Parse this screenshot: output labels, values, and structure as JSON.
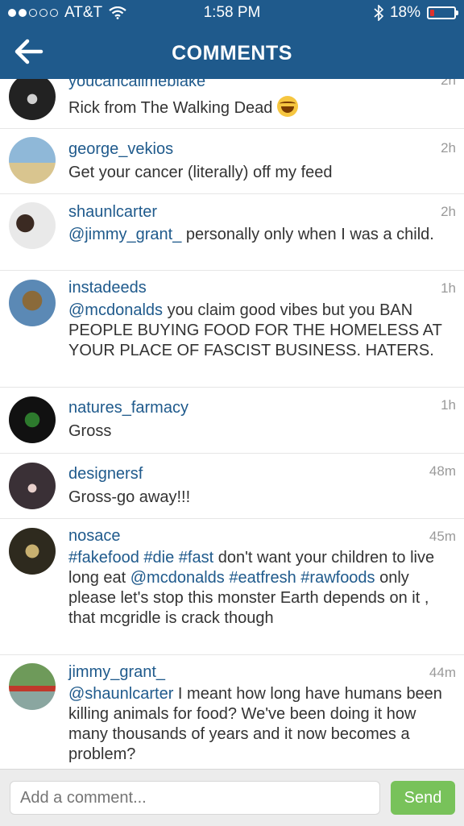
{
  "status": {
    "carrier": "AT&T",
    "time": "1:58 PM",
    "battery": "18%",
    "battery_level": 0.18
  },
  "nav": {
    "title": "COMMENTS"
  },
  "comments": [
    {
      "username": "youcancallmeblake",
      "time": "2h",
      "parts": [
        {
          "t": "text",
          "v": "Rick from The Walking Dead "
        }
      ],
      "emoji": "joy"
    },
    {
      "username": "george_vekios",
      "time": "2h",
      "parts": [
        {
          "t": "text",
          "v": "Get your cancer (literally) off my feed"
        }
      ]
    },
    {
      "username": "shaunlcarter",
      "time": "2h",
      "parts": [
        {
          "t": "mention",
          "v": "@jimmy_grant_"
        },
        {
          "t": "text",
          "v": " personally only when I was a child."
        }
      ]
    },
    {
      "username": "instadeeds",
      "time": "1h",
      "parts": [
        {
          "t": "mention",
          "v": "@mcdonalds"
        },
        {
          "t": "text",
          "v": " you claim good vibes but you BAN PEOPLE BUYING FOOD FOR THE HOMELESS AT YOUR PLACE OF FASCIST BUSINESS. HATERS."
        }
      ]
    },
    {
      "username": "natures_farmacy",
      "time": "1h",
      "parts": [
        {
          "t": "text",
          "v": "Gross"
        }
      ]
    },
    {
      "username": "designersf",
      "time": "48m",
      "parts": [
        {
          "t": "text",
          "v": "Gross-go away!!!"
        }
      ]
    },
    {
      "username": "nosace",
      "time": "45m",
      "parts": [
        {
          "t": "mention",
          "v": "#fakefood"
        },
        {
          "t": "text",
          "v": " "
        },
        {
          "t": "mention",
          "v": "#die"
        },
        {
          "t": "text",
          "v": " "
        },
        {
          "t": "mention",
          "v": "#fast"
        },
        {
          "t": "text",
          "v": " don't want your children to live long eat "
        },
        {
          "t": "mention",
          "v": "@mcdonalds"
        },
        {
          "t": "text",
          "v": "  "
        },
        {
          "t": "mention",
          "v": "#eatfresh"
        },
        {
          "t": "text",
          "v": " "
        },
        {
          "t": "mention",
          "v": "#rawfoods"
        },
        {
          "t": "text",
          "v": " only please let's stop this monster  Earth depends on it , that mcgridle is crack though"
        }
      ]
    },
    {
      "username": "jimmy_grant_",
      "time": "44m",
      "parts": [
        {
          "t": "mention",
          "v": "@shaunlcarter"
        },
        {
          "t": "text",
          "v": " I meant how long have humans been killing animals for food? We've been doing it how many thousands of years and it now becomes a problem?"
        }
      ]
    }
  ],
  "footer": {
    "placeholder": "Add a comment...",
    "send_label": "Send"
  },
  "colors": {
    "header": "#1f5a8c",
    "link": "#1f5a8c",
    "send": "#78c25a",
    "battery_low": "#e0312c"
  },
  "icons": {
    "back": "arrow-left-icon",
    "wifi": "wifi-icon",
    "bluetooth": "bluetooth-icon",
    "battery": "battery-icon",
    "signal": "signal-dots-icon"
  }
}
